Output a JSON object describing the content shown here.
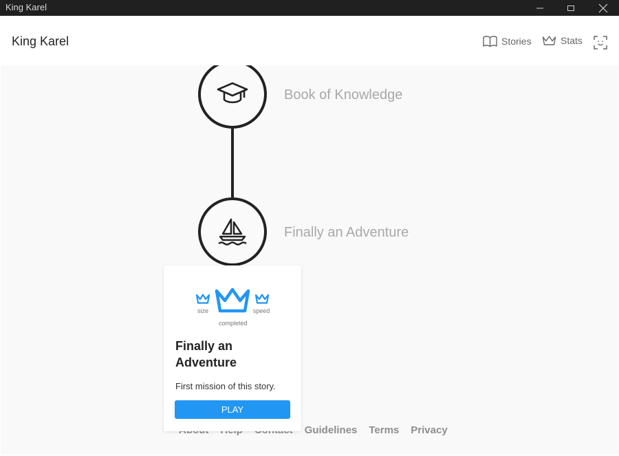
{
  "window": {
    "title": "King Karel",
    "minimize_icon": "minimize-icon",
    "maximize_icon": "maximize-icon",
    "close_icon": "close-icon"
  },
  "header": {
    "app_title": "King Karel",
    "nav": [
      {
        "label": "Stories",
        "icon": "book-icon"
      },
      {
        "label": "Stats",
        "icon": "crown-icon"
      }
    ],
    "fullscreen_icon": "focus-frame-icon"
  },
  "story_path": {
    "nodes": [
      {
        "label": "Book of Knowledge",
        "icon": "graduation-cap-icon"
      },
      {
        "label": "Finally an Adventure",
        "icon": "sailboat-icon"
      }
    ]
  },
  "mission_card": {
    "crowns": {
      "size_label": "size",
      "completed_label": "completed",
      "speed_label": "speed"
    },
    "title": "Finally an Adventure",
    "description": "First mission of this story.",
    "play_label": "PLAY"
  },
  "footer": {
    "links": [
      "About",
      "Help",
      "Contact",
      "Guidelines",
      "Terms",
      "Privacy"
    ]
  },
  "colors": {
    "accent": "#2196f3",
    "titlebar": "#202020",
    "node_border": "#222222",
    "background": "#f9f9f9"
  }
}
